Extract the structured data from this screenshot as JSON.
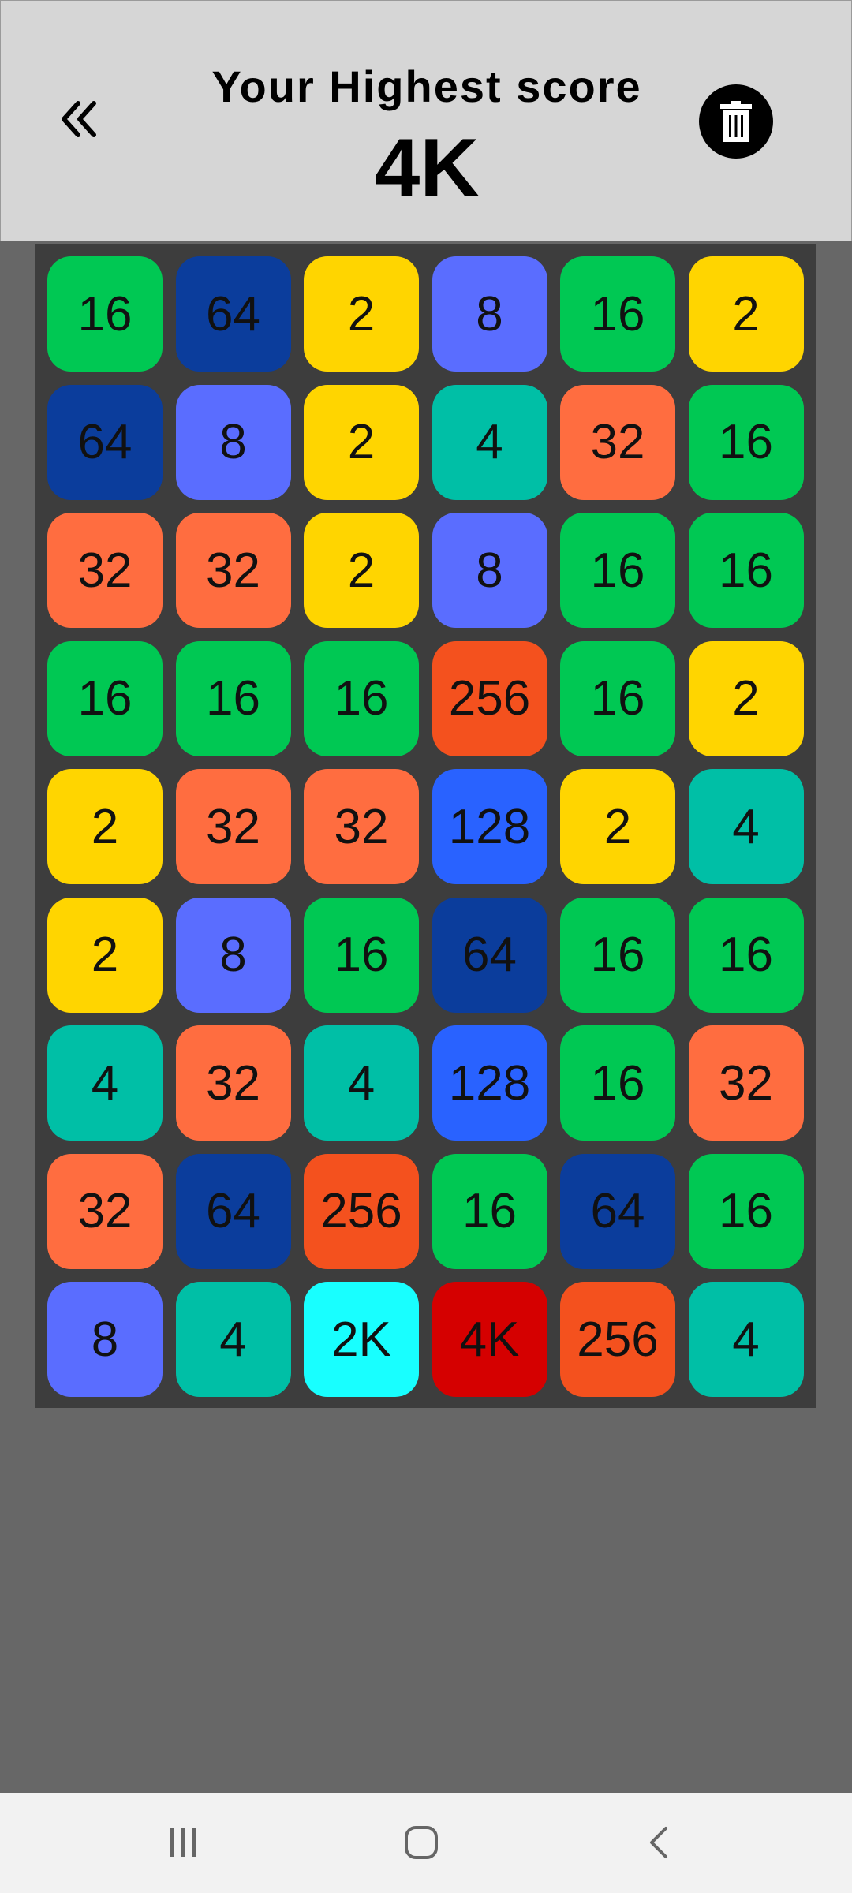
{
  "header": {
    "title": "Your Highest score",
    "score": "4K"
  },
  "icons": {
    "back": "double-chevron-left-icon",
    "trash": "trash-icon",
    "nav_recent": "recent-apps-icon",
    "nav_home": "home-icon",
    "nav_back": "back-icon"
  },
  "colors": {
    "2": "#ffd500",
    "4": "#00bfa6",
    "8": "#5a6dff",
    "16": "#00c853",
    "32": "#ff6d40",
    "64": "#0b3d9c",
    "128": "#2962ff",
    "256": "#f4511e",
    "2K": "#18ffff",
    "4K": "#d50000"
  },
  "board": {
    "rows": [
      [
        "16",
        "64",
        "2",
        "8",
        "16",
        "2"
      ],
      [
        "64",
        "8",
        "2",
        "4",
        "32",
        "16"
      ],
      [
        "32",
        "32",
        "2",
        "8",
        "16",
        "16"
      ],
      [
        "16",
        "16",
        "16",
        "256",
        "16",
        "2"
      ],
      [
        "2",
        "32",
        "32",
        "128",
        "2",
        "4"
      ],
      [
        "2",
        "8",
        "16",
        "64",
        "16",
        "16"
      ],
      [
        "4",
        "32",
        "4",
        "128",
        "16",
        "32"
      ],
      [
        "32",
        "64",
        "256",
        "16",
        "64",
        "16"
      ],
      [
        "8",
        "4",
        "2K",
        "4K",
        "256",
        "4"
      ]
    ]
  }
}
